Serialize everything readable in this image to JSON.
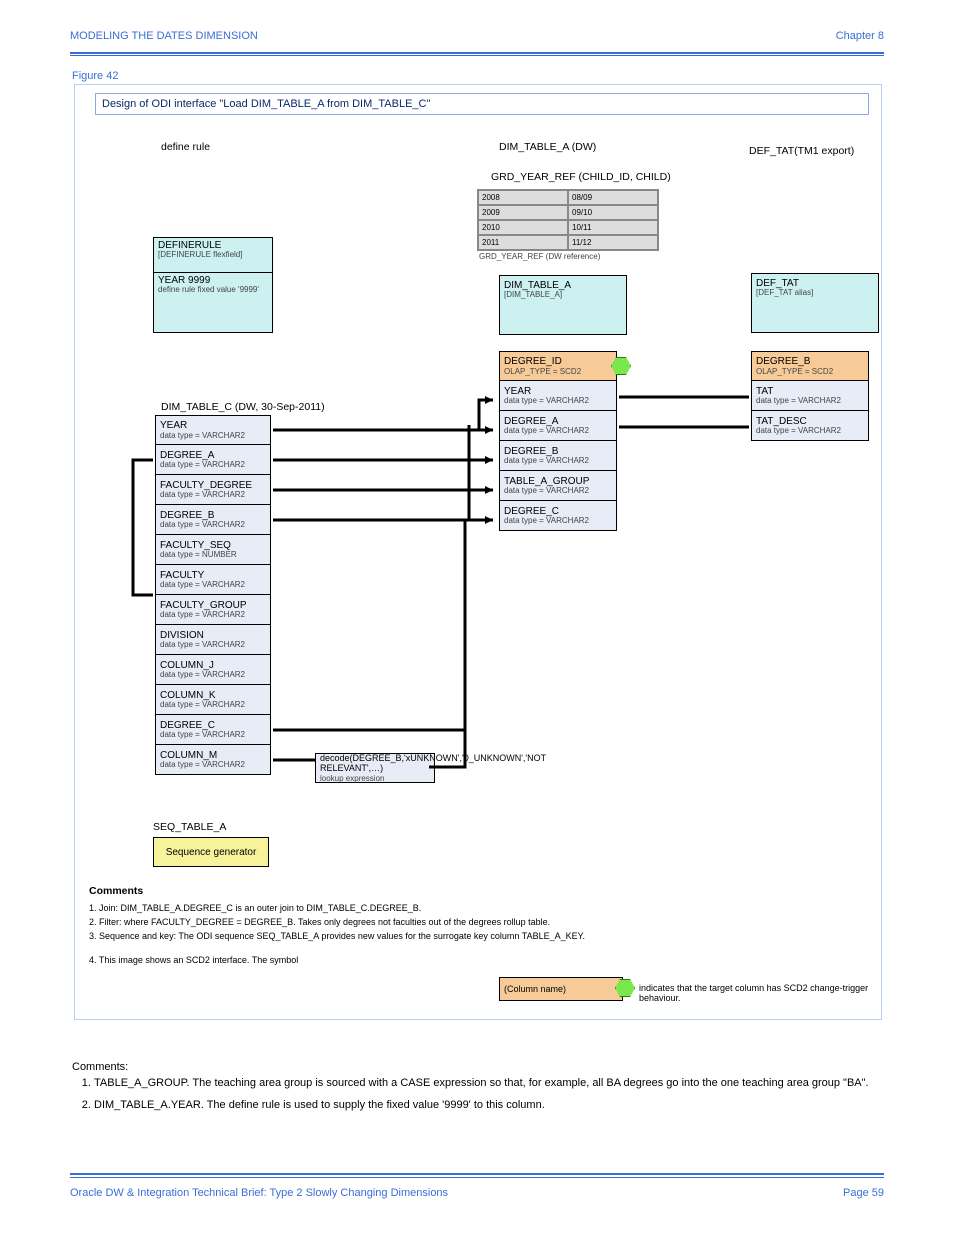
{
  "header": {
    "left": "MODELING THE DATES DIMENSION",
    "right": "Chapter 8"
  },
  "footer": {
    "left": "Oracle DW & Integration Technical Brief: Type 2 Slowly Changing Dimensions",
    "right": "Page 59"
  },
  "figure": {
    "number": "Figure 42",
    "title": "Design of ODI interface \"Load DIM_TABLE_A from DIM_TABLE_C\"",
    "headings": {
      "define": "define rule",
      "dim_table": "DIM_TABLE_A (DW)",
      "def_tat": "DEF_TAT(TM1 export)",
      "yearref": "GRD_YEAR_REF (CHILD_ID, CHILD)"
    },
    "yearref": [
      [
        "2008",
        "08/09"
      ],
      [
        "2009",
        "09/10"
      ],
      [
        "2010",
        "10/11"
      ],
      [
        "2011",
        "11/12"
      ]
    ],
    "yearref_label": "GRD_YEAR_REF (DW reference)",
    "define": {
      "title": "DEFINERULE",
      "sub": "[DEFINERULE flexfield]",
      "row": "YEAR  9999",
      "rowsub": "define rule fixed value '9999'"
    },
    "dim": {
      "title": "DIM_TABLE_A",
      "sub": "[DIM_TABLE_A]",
      "rows": [
        {
          "l": "DEGREE_ID",
          "s": "OLAP_TYPE = SCD2"
        },
        {
          "l": "YEAR",
          "s": "data type = VARCHAR2"
        },
        {
          "l": "DEGREE_A",
          "s": "data type = VARCHAR2"
        },
        {
          "l": "DEGREE_B",
          "s": "data type = VARCHAR2"
        },
        {
          "l": "TABLE_A_GROUP",
          "s": "data type = VARCHAR2"
        },
        {
          "l": "DEGREE_C",
          "s": "data type = VARCHAR2"
        }
      ]
    },
    "tat": {
      "title": "DEF_TAT",
      "sub": "[DEF_TAT alias]",
      "rows": [
        {
          "l": "DEGREE_B",
          "s": "OLAP_TYPE = SCD2"
        },
        {
          "l": "TAT",
          "s": "data type = VARCHAR2"
        },
        {
          "l": "TAT_DESC",
          "s": "data type = VARCHAR2"
        }
      ]
    },
    "left": {
      "title": "DIM_TABLE_C (DW, 30-Sep-2011)",
      "rows": [
        {
          "l": "YEAR",
          "s": "data type = VARCHAR2"
        },
        {
          "l": "DEGREE_A",
          "s": "data type = VARCHAR2"
        },
        {
          "l": "FACULTY_DEGREE",
          "s": "data type = VARCHAR2"
        },
        {
          "l": "DEGREE_B",
          "s": "data type = VARCHAR2"
        },
        {
          "l": "FACULTY_SEQ",
          "s": "data type = NUMBER"
        },
        {
          "l": "FACULTY",
          "s": "data type = VARCHAR2"
        },
        {
          "l": "FACULTY_GROUP",
          "s": "data type = VARCHAR2"
        },
        {
          "l": "DIVISION",
          "s": "data type = VARCHAR2"
        },
        {
          "l": "COLUMN_J",
          "s": "data type = VARCHAR2"
        },
        {
          "l": "COLUMN_K",
          "s": "data type = VARCHAR2"
        },
        {
          "l": "DEGREE_C",
          "s": "data type = VARCHAR2"
        },
        {
          "l": "COLUMN_M",
          "s": "data type = VARCHAR2"
        }
      ]
    },
    "midbox": {
      "l": "decode(DEGREE_B,'xUNKNOWN','0_UNKNOWN','NOT RELEVANT',…)",
      "s": "lookup expression"
    },
    "yellow": "Sequence generator",
    "seq_title": "SEQ_TABLE_A",
    "legend": {
      "title": "Comments",
      "l1": "1. Join:  DIM_TABLE_A.DEGREE_C is an outer join to DIM_TABLE_C.DEGREE_B.",
      "l2": "2. Filter: where FACULTY_DEGREE = DEGREE_B. Takes only degrees not faculties out of the degrees rollup table.",
      "l3": "3. Sequence and key: The ODI sequence SEQ_TABLE_A provides new values for the surrogate key column TABLE_A_KEY.",
      "l4": "4. This image shows an SCD2 interface. The symbol",
      "scd2": "(Column name)",
      "scd2txt": "indicates that the target column has SCD2 change-trigger behaviour."
    }
  },
  "body": {
    "heading": "Comments:",
    "items": [
      "TABLE_A_GROUP. The teaching area group is sourced with a CASE expression so that, for example, all BA degrees go into the one teaching area group \"BA\".",
      "DIM_TABLE_A.YEAR. The define rule is used to supply the fixed value '9999' to this column."
    ]
  }
}
